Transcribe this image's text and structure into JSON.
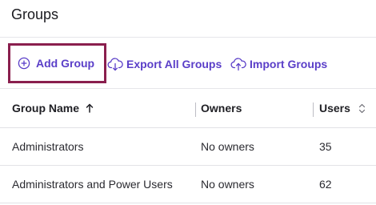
{
  "page": {
    "title": "Groups"
  },
  "toolbar": {
    "add_group": {
      "label": "Add Group",
      "icon": "plus-circle-icon"
    },
    "export_all": {
      "label": "Export All Groups",
      "icon": "cloud-download-icon"
    },
    "import_groups": {
      "label": "Import Groups",
      "icon": "cloud-upload-icon"
    },
    "accent_color": "#5a3ec8",
    "focus_outline_color": "#8a1f4e"
  },
  "table": {
    "columns": [
      {
        "label": "Group Name",
        "sort": "ascending",
        "icon": "arrow-up-icon"
      },
      {
        "label": "Owners"
      },
      {
        "label": "Users",
        "sort": "sortable",
        "icon": "sort-updown-icon"
      }
    ],
    "rows": [
      {
        "name": "Administrators",
        "owners": "No owners",
        "users": "35"
      },
      {
        "name": "Administrators and Power Users",
        "owners": "No owners",
        "users": "62"
      }
    ]
  }
}
